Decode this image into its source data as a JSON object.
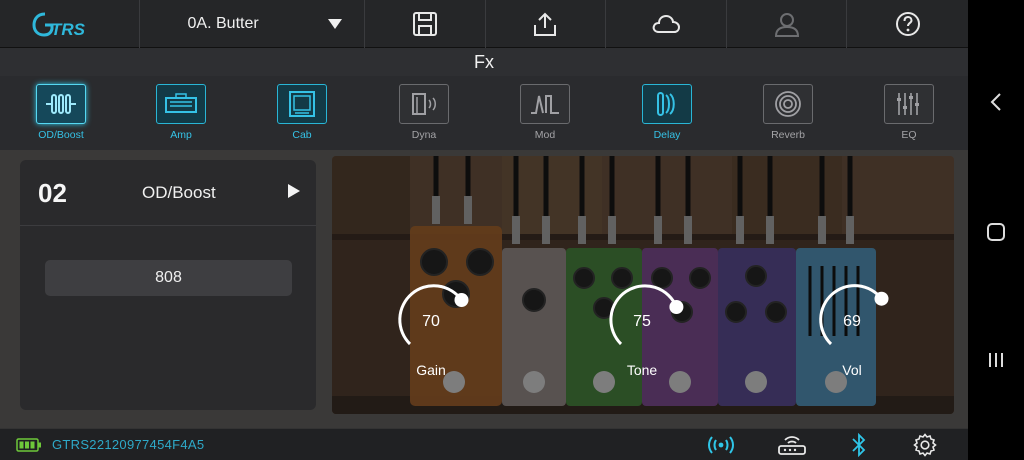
{
  "app": {
    "logo_text": "GTRS"
  },
  "toolbar": {
    "preset_name": "0A. Butter",
    "buttons": [
      "save-icon",
      "upload-icon",
      "cloud-icon",
      "user-icon",
      "help-icon"
    ]
  },
  "fx": {
    "title": "Fx"
  },
  "modules": [
    {
      "label": "OD/Boost",
      "icon": "od-boost-icon",
      "state": "selected"
    },
    {
      "label": "Amp",
      "icon": "amp-icon",
      "state": "on"
    },
    {
      "label": "Cab",
      "icon": "cab-icon",
      "state": "on"
    },
    {
      "label": "Dyna",
      "icon": "dyna-icon",
      "state": "off"
    },
    {
      "label": "Mod",
      "icon": "mod-icon",
      "state": "off"
    },
    {
      "label": "Delay",
      "icon": "delay-icon",
      "state": "on"
    },
    {
      "label": "Reverb",
      "icon": "reverb-icon",
      "state": "off"
    },
    {
      "label": "EQ",
      "icon": "eq-icon",
      "state": "off"
    }
  ],
  "slot": {
    "number": "02",
    "name": "OD/Boost",
    "model": "808"
  },
  "knobs": [
    {
      "label": "Gain",
      "value": "70",
      "level": 70
    },
    {
      "label": "Tone",
      "value": "75",
      "level": 75
    },
    {
      "label": "Vol",
      "value": "69",
      "level": 69
    }
  ],
  "status": {
    "device_id": "GTRS22120977454F4A5",
    "icons": [
      "broadcast-icon",
      "router-icon",
      "bluetooth-icon",
      "settings-icon"
    ]
  },
  "colors": {
    "accent": "#2fc6e8",
    "background": "#1d1d1f",
    "battery": "#6ec93a"
  }
}
